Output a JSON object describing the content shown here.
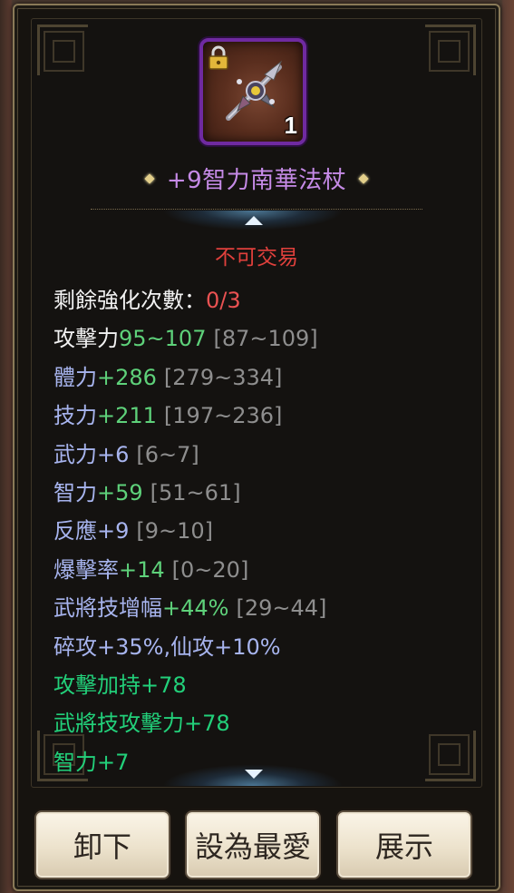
{
  "item": {
    "name": "+9智力南華法杖",
    "quantity": "1",
    "locked": true,
    "tradeable_text": "不可交易",
    "rarity_color": "#c58ae6"
  },
  "stats": {
    "enhance_label": "剩餘強化次數：",
    "enhance_value": "0/3",
    "lines": [
      {
        "label": "攻擊力",
        "value": "95~107",
        "range": "[87~109]"
      },
      {
        "label": "體力",
        "value": "+286",
        "range": "[279~334]"
      },
      {
        "label": "技力",
        "value": "+211",
        "range": "[197~236]"
      },
      {
        "label": "武力",
        "value": "+6",
        "range": "[6~7]"
      },
      {
        "label": "智力",
        "value": "+59",
        "range": "[51~61]"
      },
      {
        "label": "反應",
        "value": "+9",
        "range": "[9~10]"
      },
      {
        "label": "爆擊率",
        "value": "+14",
        "range": "[0~20]"
      },
      {
        "label": "武將技增幅",
        "value": "+44%",
        "range": "[29~44]"
      }
    ],
    "special_line": "碎攻+35%,仙攻+10%",
    "bonus_lines": [
      "攻擊加持+78",
      "武將技攻擊力+78",
      "智力+7"
    ]
  },
  "buttons": {
    "unequip": "卸下",
    "favorite": "設為最愛",
    "showcase": "展示"
  },
  "icons": {
    "lock": "lock-icon",
    "weapon": "staff-weapon-icon",
    "scroll_up": "arrow-up-icon",
    "scroll_down": "arrow-down-icon"
  },
  "colors": {
    "stat_label": "#a7b4ee",
    "stat_value": "#5ed17a",
    "stat_range": "#8e8e8e",
    "warning": "#e0403c",
    "bonus": "#22d07a"
  }
}
